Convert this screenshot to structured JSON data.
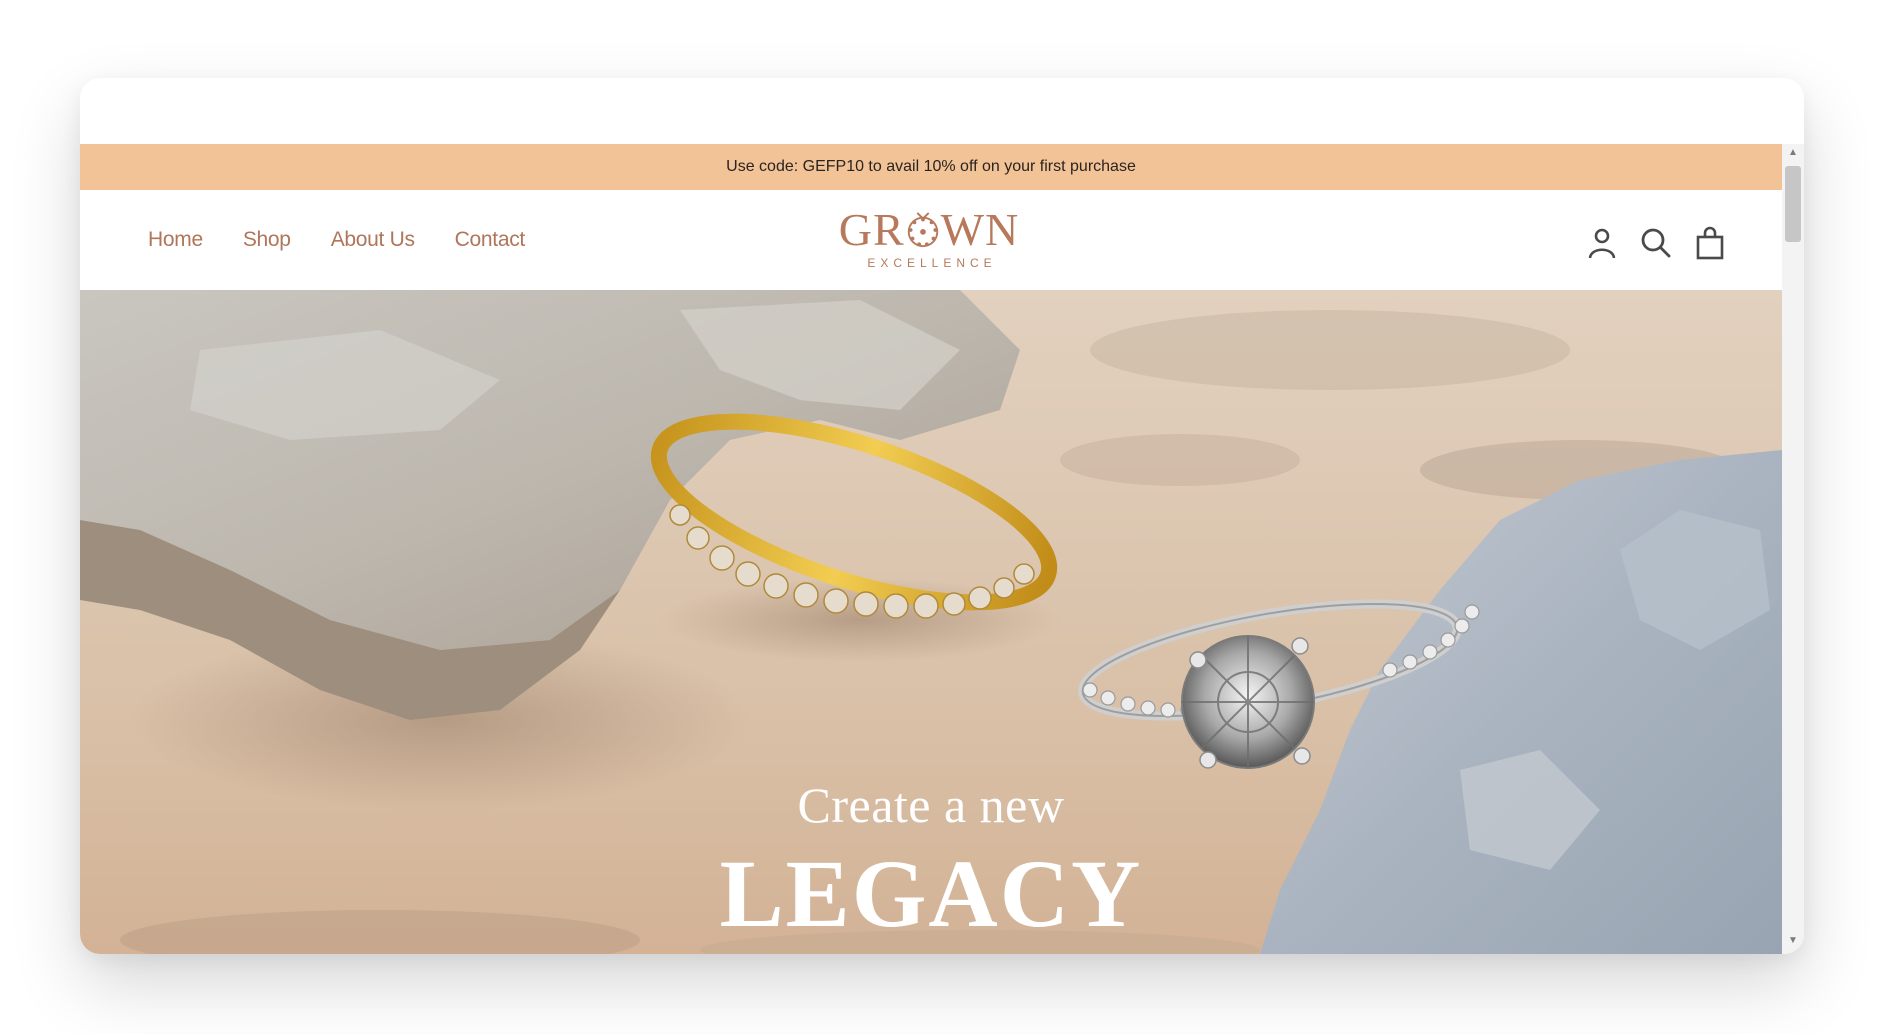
{
  "announcement": "Use code: GEFP10 to avail 10% off on your first purchase",
  "nav": {
    "items": [
      "Home",
      "Shop",
      "About Us",
      "Contact"
    ]
  },
  "logo": {
    "word_left": "GR",
    "word_right": "WN",
    "subtitle": "EXCELLENCE"
  },
  "header_icons": [
    "account-icon",
    "search-icon",
    "shopping-bag-icon"
  ],
  "hero": {
    "line1": "Create a new",
    "line2": "LEGACY"
  },
  "colors": {
    "announcement_bg": "#f1c397",
    "brand": "#b8785c",
    "nav_text": "#b0755a",
    "icon": "#4a4a4a"
  }
}
